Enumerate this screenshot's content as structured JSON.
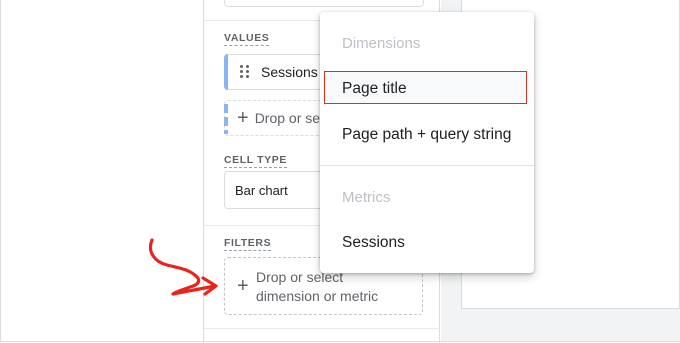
{
  "panel": {
    "values_label": "VALUES",
    "value_chip": "Sessions",
    "values_drop": "Drop or select",
    "cell_type_label": "CELL TYPE",
    "cell_type_value": "Bar chart",
    "filters_label": "FILTERS",
    "filters_drop_line1": "Drop or select",
    "filters_drop_line2": "dimension or metric"
  },
  "menu": {
    "dimensions_header": "Dimensions",
    "items_dimensions": [
      "Page title",
      "Page path + query string"
    ],
    "metrics_header": "Metrics",
    "items_metrics": [
      "Sessions"
    ],
    "selected": "Page title"
  },
  "colors": {
    "annotation_arrow": "#e8251c",
    "selection_border": "#d93025",
    "chip_accent": "#8ab4f8"
  },
  "icons": {
    "drag": "drag-handle-icon",
    "plus": "plus-icon",
    "arrow": "annotation-arrow-icon"
  }
}
